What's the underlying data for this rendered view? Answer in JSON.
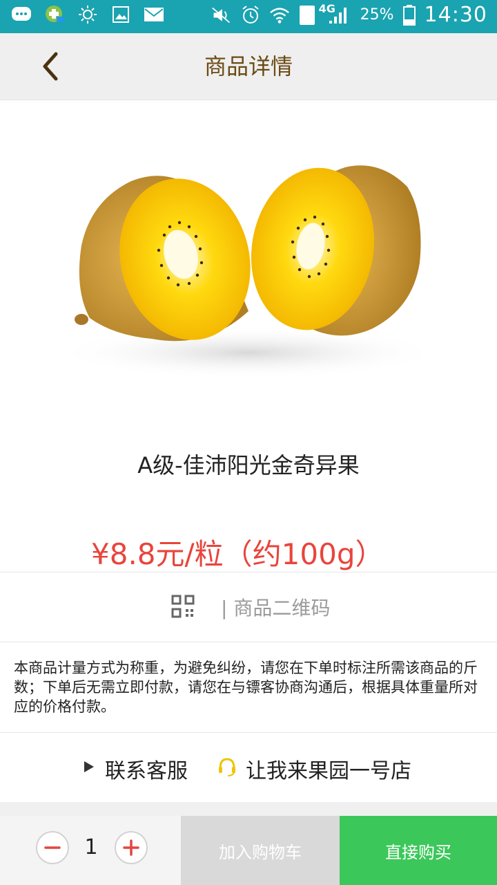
{
  "status_bar": {
    "network": "4G",
    "sim": "1",
    "battery": "25%",
    "time": "14:30"
  },
  "header": {
    "title": "商品详情"
  },
  "product": {
    "name": "A级-佳沛阳光金奇异果",
    "price": "¥8.8元/粒（约100g）",
    "image_icon": "kiwi-image"
  },
  "qr": {
    "label": "| 商品二维码"
  },
  "description": "本商品计量方式为称重，为避免纠纷，请您在下单时标注所需该商品的斤数；下单后无需立即付款，请您在与镖客协商沟通后，根据具体重量所对应的价格付款。",
  "service": {
    "contact_label": "联系客服",
    "store_name": "让我来果园一号店"
  },
  "bottom_bar": {
    "quantity": "1",
    "add_cart_label": "加入购物车",
    "buy_now_label": "直接购买"
  },
  "colors": {
    "status_bar": "#1aa3b0",
    "price": "#e8453c",
    "title": "#6b4a14",
    "buy_now": "#3cc75b",
    "add_cart": "#d9d9d9",
    "qty_icon": "#e0473e",
    "headset": "#f0c400"
  }
}
